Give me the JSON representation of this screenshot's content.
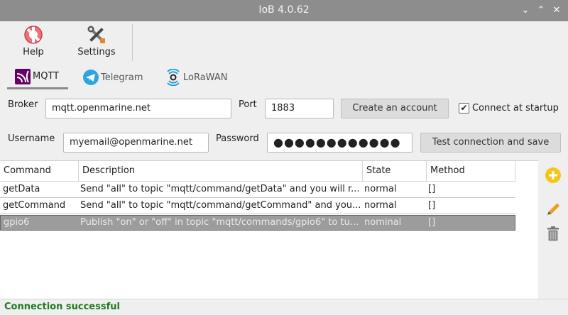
{
  "window": {
    "title": "IoB 4.0.62",
    "controls": {
      "minimize": "⌄",
      "maximize": "⌃",
      "close": "✕"
    }
  },
  "toolbar": {
    "help_label": "Help",
    "settings_label": "Settings"
  },
  "tabs": [
    {
      "label": "MQTT",
      "icon": "mqtt-icon",
      "active": true
    },
    {
      "label": "Telegram",
      "icon": "telegram-icon",
      "active": false
    },
    {
      "label": "LoRaWAN",
      "icon": "lorawan-icon",
      "active": false
    }
  ],
  "form": {
    "broker_label": "Broker",
    "broker_value": "mqtt.openmarine.net",
    "port_label": "Port",
    "port_value": "1883",
    "create_account_label": "Create an account",
    "connect_startup_label": "Connect at startup",
    "connect_startup_checked": "✔",
    "username_label": "Username",
    "username_value": "myemail@openmarine.net",
    "password_label": "Password",
    "password_value": "●●●●●●●●●●●●",
    "test_save_label": "Test connection and save"
  },
  "table": {
    "headers": [
      "Command",
      "Description",
      "State",
      "Method"
    ],
    "rows": [
      {
        "command": "getData",
        "description": "Send \"all\" to topic \"mqtt/command/getData\" and you will r...",
        "state": "normal",
        "method": "[]"
      },
      {
        "command": "getCommand",
        "description": "Send \"all\" to topic \"mqtt/command/getCommand\" and you...",
        "state": "normal",
        "method": "[]"
      },
      {
        "command": "gpio6",
        "description": "Publish \"on\" or \"off\" in topic \"mqtt/commands/gpio6\" to tu...",
        "state": "nominal",
        "method": "[]"
      }
    ],
    "selected_row": 2
  },
  "sidebar": {
    "icons": [
      "add-icon",
      "edit-icon",
      "delete-icon"
    ]
  },
  "status": {
    "text": "Connection successful",
    "color": "#1f7a1f"
  },
  "colors": {
    "titlebar": "#8d8d8d",
    "selection": "#9c9c9c",
    "add": "#f2c200",
    "edit": "#e6a21a"
  }
}
